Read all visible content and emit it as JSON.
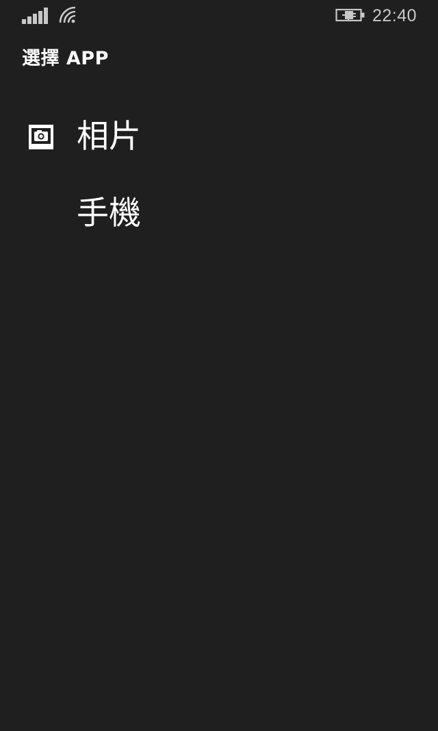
{
  "status_bar": {
    "signal_icon": "signal-strength-icon",
    "wifi_icon": "wifi-icon",
    "battery_icon": "battery-charging-icon",
    "time": "22:40",
    "color": "#c8c8c8"
  },
  "header": {
    "title": "選擇 APP"
  },
  "apps": [
    {
      "label": "相片",
      "icon": "photos-camera-icon"
    },
    {
      "label": "手機",
      "icon": ""
    }
  ],
  "colors": {
    "background": "#1f1f1f",
    "text": "#ffffff"
  }
}
